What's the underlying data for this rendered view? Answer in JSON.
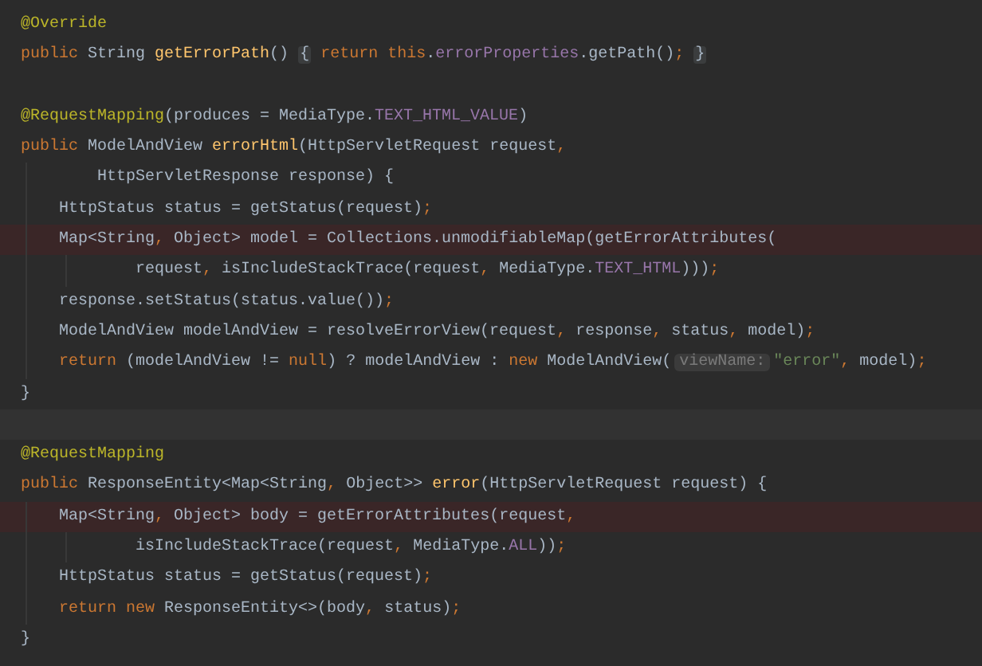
{
  "editor": {
    "lines": [
      {
        "kind": "normal",
        "tokens": [
          {
            "kind": "annotation",
            "text": "@Override"
          }
        ]
      },
      {
        "kind": "normal",
        "tokens": [
          {
            "kind": "keyword",
            "text": "public "
          },
          {
            "kind": "plain",
            "text": "String "
          },
          {
            "kind": "declaration",
            "text": "getErrorPath"
          },
          {
            "kind": "plain",
            "text": "() "
          },
          {
            "kind": "fold",
            "text": "{"
          },
          {
            "kind": "keyword",
            "text": " return this"
          },
          {
            "kind": "plain",
            "text": "."
          },
          {
            "kind": "field",
            "text": "errorProperties"
          },
          {
            "kind": "plain",
            "text": ".getPath()"
          },
          {
            "kind": "keyword",
            "text": "; "
          },
          {
            "kind": "fold",
            "text": "}"
          }
        ]
      },
      {
        "kind": "normal"
      },
      {
        "kind": "normal",
        "tokens": [
          {
            "kind": "annotation",
            "text": "@RequestMapping"
          },
          {
            "kind": "plain",
            "text": "(produces = MediaType."
          },
          {
            "kind": "field",
            "text": "TEXT_HTML_VALUE"
          },
          {
            "kind": "plain",
            "text": ")"
          }
        ]
      },
      {
        "kind": "normal",
        "tokens": [
          {
            "kind": "keyword",
            "text": "public "
          },
          {
            "kind": "plain",
            "text": "ModelAndView "
          },
          {
            "kind": "declaration",
            "text": "errorHtml"
          },
          {
            "kind": "plain",
            "text": "(HttpServletRequest request"
          },
          {
            "kind": "keyword",
            "text": ","
          }
        ]
      },
      {
        "kind": "normal",
        "tokens": [
          {
            "kind": "plain",
            "text": "        HttpServletResponse response) {"
          }
        ]
      },
      {
        "kind": "normal",
        "tokens": [
          {
            "kind": "plain",
            "text": "    HttpStatus status = getStatus(request)"
          },
          {
            "kind": "keyword",
            "text": ";"
          }
        ]
      },
      {
        "kind": "error",
        "tokens": [
          {
            "kind": "plain",
            "text": "    Map<String"
          },
          {
            "kind": "keyword",
            "text": ", "
          },
          {
            "kind": "plain",
            "text": "Object> model = Collections.unmodifiableMap(getErrorAttributes("
          }
        ]
      },
      {
        "kind": "normal",
        "tokens": [
          {
            "kind": "plain",
            "text": "            request"
          },
          {
            "kind": "keyword",
            "text": ", "
          },
          {
            "kind": "plain",
            "text": "isIncludeStackTrace(request"
          },
          {
            "kind": "keyword",
            "text": ", "
          },
          {
            "kind": "plain",
            "text": "MediaType."
          },
          {
            "kind": "field",
            "text": "TEXT_HTML"
          },
          {
            "kind": "plain",
            "text": ")))"
          },
          {
            "kind": "keyword",
            "text": ";"
          }
        ]
      },
      {
        "kind": "normal",
        "tokens": [
          {
            "kind": "plain",
            "text": "    response.setStatus(status.value())"
          },
          {
            "kind": "keyword",
            "text": ";"
          }
        ]
      },
      {
        "kind": "normal",
        "tokens": [
          {
            "kind": "plain",
            "text": "    ModelAndView modelAndView = resolveErrorView(request"
          },
          {
            "kind": "keyword",
            "text": ", "
          },
          {
            "kind": "plain",
            "text": "response"
          },
          {
            "kind": "keyword",
            "text": ", "
          },
          {
            "kind": "plain",
            "text": "status"
          },
          {
            "kind": "keyword",
            "text": ", "
          },
          {
            "kind": "plain",
            "text": "model)"
          },
          {
            "kind": "keyword",
            "text": ";"
          }
        ]
      },
      {
        "kind": "normal",
        "tokens": [
          {
            "kind": "keyword",
            "text": "    return "
          },
          {
            "kind": "plain",
            "text": "(modelAndView != "
          },
          {
            "kind": "keyword",
            "text": "null"
          },
          {
            "kind": "plain",
            "text": ") ? modelAndView : "
          },
          {
            "kind": "keyword",
            "text": "new "
          },
          {
            "kind": "plain",
            "text": "ModelAndView("
          },
          {
            "kind": "hint",
            "text": "viewName:"
          },
          {
            "kind": "string",
            "text": "\"error\""
          },
          {
            "kind": "keyword",
            "text": ", "
          },
          {
            "kind": "plain",
            "text": "model)"
          },
          {
            "kind": "keyword",
            "text": ";"
          }
        ]
      },
      {
        "kind": "normal",
        "tokens": [
          {
            "kind": "plain",
            "text": "}"
          }
        ]
      },
      {
        "kind": "current"
      },
      {
        "kind": "normal",
        "tokens": [
          {
            "kind": "annotation",
            "text": "@RequestMapping"
          }
        ]
      },
      {
        "kind": "normal",
        "tokens": [
          {
            "kind": "keyword",
            "text": "public "
          },
          {
            "kind": "plain",
            "text": "ResponseEntity<Map<String"
          },
          {
            "kind": "keyword",
            "text": ", "
          },
          {
            "kind": "plain",
            "text": "Object>> "
          },
          {
            "kind": "declaration",
            "text": "error"
          },
          {
            "kind": "plain",
            "text": "(HttpServletRequest request) {"
          }
        ]
      },
      {
        "kind": "error",
        "tokens": [
          {
            "kind": "plain",
            "text": "    Map<String"
          },
          {
            "kind": "keyword",
            "text": ", "
          },
          {
            "kind": "plain",
            "text": "Object> body = getErrorAttributes(request"
          },
          {
            "kind": "keyword",
            "text": ","
          }
        ]
      },
      {
        "kind": "normal",
        "tokens": [
          {
            "kind": "plain",
            "text": "            isIncludeStackTrace(request"
          },
          {
            "kind": "keyword",
            "text": ", "
          },
          {
            "kind": "plain",
            "text": "MediaType."
          },
          {
            "kind": "field",
            "text": "ALL"
          },
          {
            "kind": "plain",
            "text": "))"
          },
          {
            "kind": "keyword",
            "text": ";"
          }
        ]
      },
      {
        "kind": "normal",
        "tokens": [
          {
            "kind": "plain",
            "text": "    HttpStatus status = getStatus(request)"
          },
          {
            "kind": "keyword",
            "text": ";"
          }
        ]
      },
      {
        "kind": "normal",
        "tokens": [
          {
            "kind": "keyword",
            "text": "    return new "
          },
          {
            "kind": "plain",
            "text": "ResponseEntity<>(body"
          },
          {
            "kind": "keyword",
            "text": ", "
          },
          {
            "kind": "plain",
            "text": "status)"
          },
          {
            "kind": "keyword",
            "text": ";"
          }
        ]
      },
      {
        "kind": "normal",
        "tokens": [
          {
            "kind": "plain",
            "text": "}"
          }
        ]
      }
    ]
  }
}
